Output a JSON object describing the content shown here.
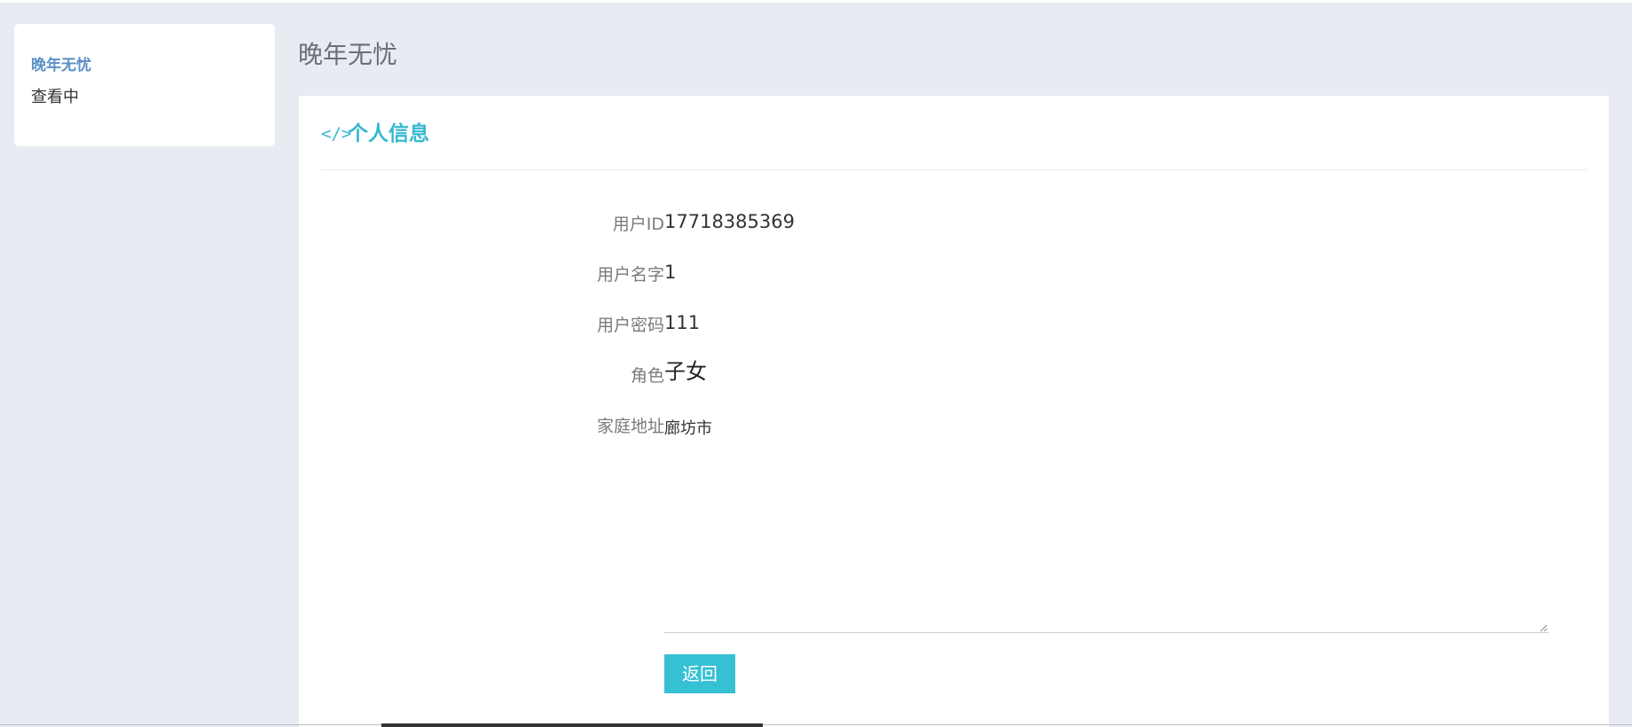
{
  "sidebar": {
    "brand": "晚年无忧",
    "status": "查看中"
  },
  "header": {
    "title": "晚年无忧"
  },
  "card": {
    "icon": "code-icon",
    "title": "个人信息"
  },
  "profile": {
    "fields": [
      {
        "label": "用户ID",
        "value": "17718385369"
      },
      {
        "label": "用户名字",
        "value": "1"
      },
      {
        "label": "用户密码",
        "value": "111"
      },
      {
        "label": "角色",
        "value": "子女"
      },
      {
        "label": "家庭地址",
        "value": "廊坊市"
      }
    ]
  },
  "actions": {
    "back_label": "返回"
  },
  "colors": {
    "accent": "#36c0d4",
    "brand": "#5a8fc7",
    "background": "#e8ebf2"
  }
}
